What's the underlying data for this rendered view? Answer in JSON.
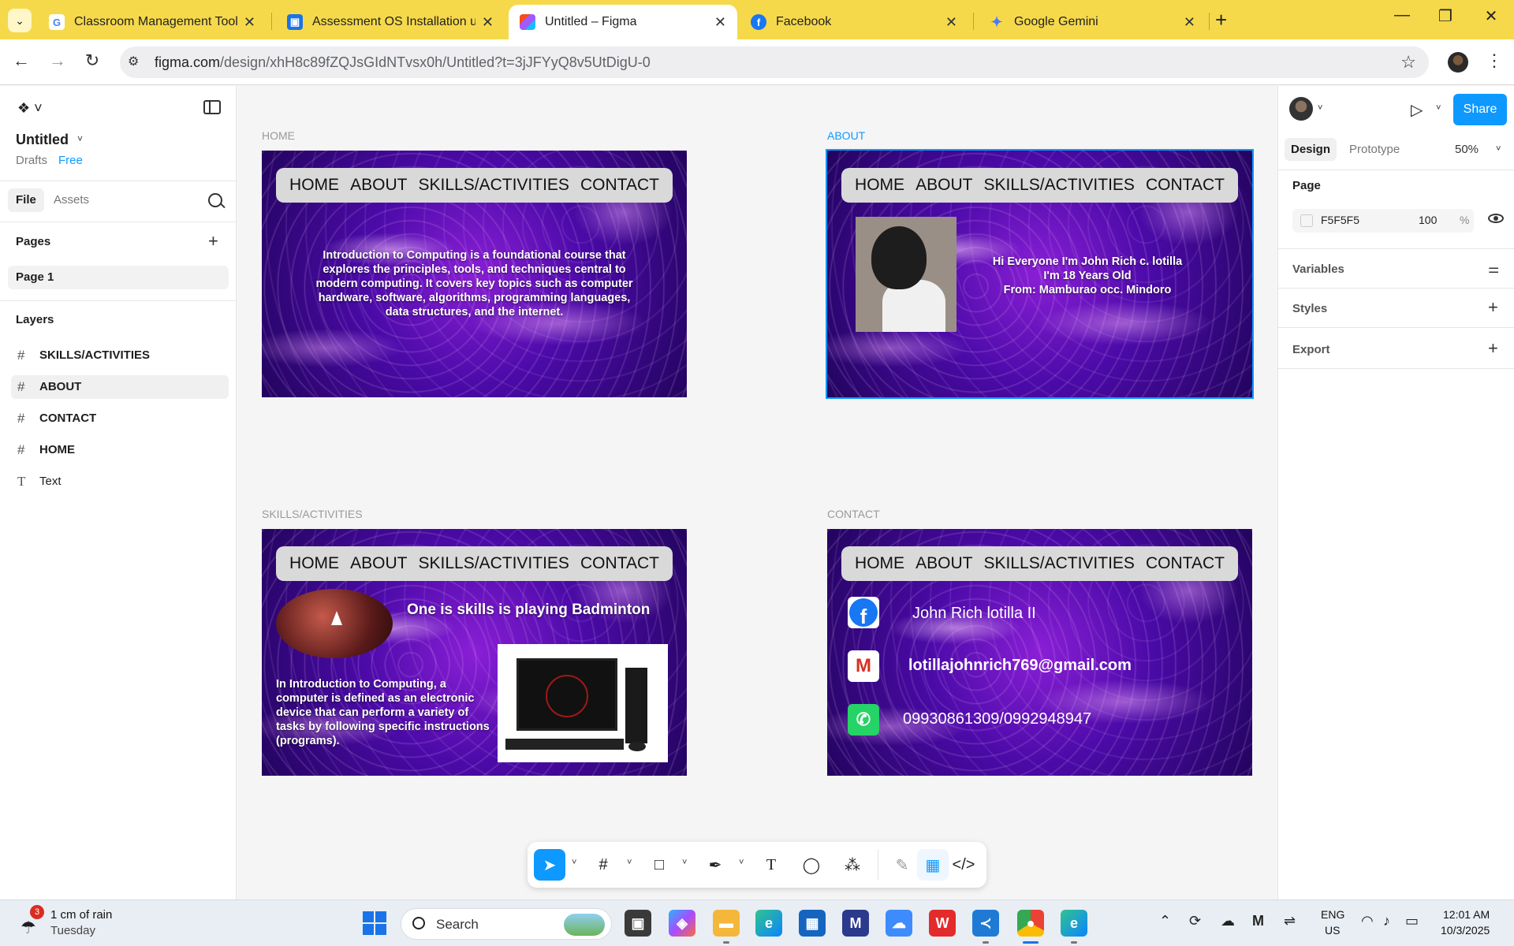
{
  "browser": {
    "tabs": [
      {
        "title": "Classroom Management Tools &",
        "icon": "google-icon"
      },
      {
        "title": "Assessment OS Installation usin",
        "icon": "classroom-icon"
      },
      {
        "title": "Untitled – Figma",
        "icon": "figma-icon"
      },
      {
        "title": "Facebook",
        "icon": "facebook-icon"
      },
      {
        "title": "Google Gemini",
        "icon": "gemini-icon"
      }
    ],
    "url_host": "figma.com",
    "url_path": "/design/xhH8c89fZQJsGIdNTvsx0h/Untitled?t=3jJFYyQ8v5UtDigU-0"
  },
  "left_panel": {
    "file_title": "Untitled",
    "drafts": "Drafts",
    "plan": "Free",
    "tabs": [
      "File",
      "Assets"
    ],
    "pages_label": "Pages",
    "pages": [
      "Page 1"
    ],
    "layers_label": "Layers",
    "layers": [
      {
        "name": "SKILLS/ACTIVITIES",
        "type": "frame"
      },
      {
        "name": "ABOUT",
        "type": "frame",
        "selected": true
      },
      {
        "name": "CONTACT",
        "type": "frame"
      },
      {
        "name": "HOME",
        "type": "frame"
      },
      {
        "name": "Text",
        "type": "text"
      }
    ]
  },
  "canvas": {
    "nav_items": [
      "HOME",
      "ABOUT",
      "SKILLS/ACTIVITIES",
      "CONTACT"
    ],
    "home": {
      "label": "HOME",
      "body": "Introduction to Computing is a foundational course that explores the principles, tools, and techniques central to modern computing. It covers key topics such as computer hardware, software, algorithms, programming languages, data structures, and the internet."
    },
    "about": {
      "label": "ABOUT",
      "line1": "Hi Everyone I'm John Rich c. lotilla",
      "line2": "I'm 18 Years Old",
      "line3": "From: Mamburao occ. Mindoro"
    },
    "skills": {
      "label": "SKILLS/ACTIVITIES",
      "headline": "One is skills is playing Badminton",
      "body": "In Introduction to Computing, a computer is defined as an electronic device that can perform a variety of tasks by following specific instructions (programs)."
    },
    "contact": {
      "label": "CONTACT",
      "name": "John Rich lotilla II",
      "email": "lotillajohnrich769@gmail.com",
      "phone": "09930861309/0992948947"
    }
  },
  "right_panel": {
    "share": "Share",
    "tabs": [
      "Design",
      "Prototype"
    ],
    "zoom": "50%",
    "page_label": "Page",
    "page_color": "F5F5F5",
    "page_opacity": "100",
    "opacity_unit": "%",
    "sections": [
      "Variables",
      "Styles",
      "Export"
    ]
  },
  "taskbar": {
    "weather_badge": "3",
    "weather_line1": "1 cm of rain",
    "weather_line2": "Tuesday",
    "search_label": "Search",
    "lang1": "ENG",
    "lang2": "US",
    "time": "12:01 AM",
    "date": "10/3/2025"
  },
  "colors": {
    "figma_blue": "#0d99ff",
    "tabstrip": "#f6d94a",
    "frame_purple": "#6a12c4"
  }
}
